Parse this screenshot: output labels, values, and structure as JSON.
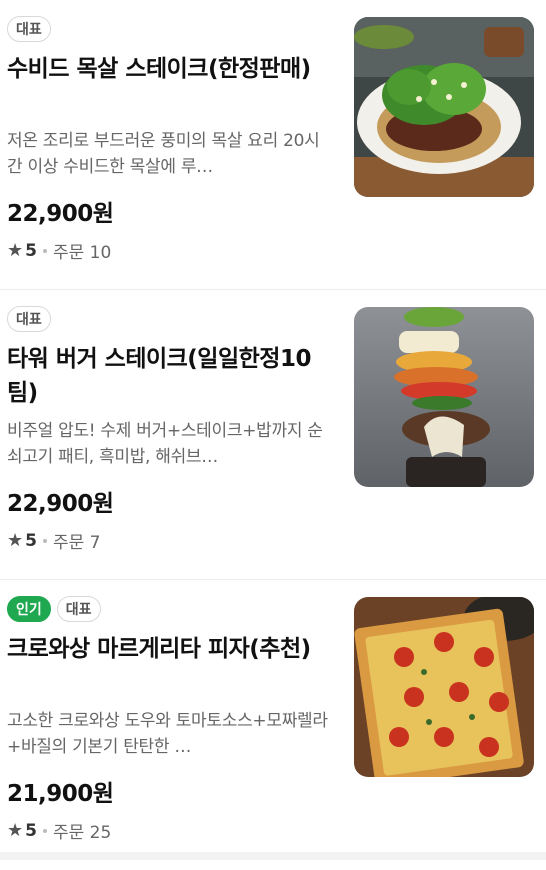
{
  "menu": {
    "items": [
      {
        "badges": [
          "대표"
        ],
        "title": "수비드 목살 스테이크(한정판매)",
        "description": "저온 조리로 부드러운 풍미의 목살 요리 20시간 이상 수비드한 목살에 루…",
        "price": "22,900원",
        "rating": "5",
        "orders": "주문 10",
        "image_icon": "steak-salad-photo"
      },
      {
        "badges": [
          "대표"
        ],
        "title": "타워 버거 스테이크(일일한정10팀)",
        "description": "비주얼 압도! 수제 버거+스테이크+밥까지 순쇠고기 패티, 흑미밥, 해쉬브…",
        "price": "22,900원",
        "rating": "5",
        "orders": "주문 7",
        "image_icon": "tower-burger-photo"
      },
      {
        "badges": [
          "인기",
          "대표"
        ],
        "title": "크로와상 마르게리타 피자(추천)",
        "description": "고소한 크로와상 도우와 토마토소스+모짜렐라+바질의 기본기 탄탄한 …",
        "price": "21,900원",
        "rating": "5",
        "orders": "주문 25",
        "image_icon": "margherita-pizza-photo"
      }
    ]
  },
  "colors": {
    "popular_badge": "#1fa84f",
    "text": "#111111",
    "sub_text": "#666666"
  }
}
